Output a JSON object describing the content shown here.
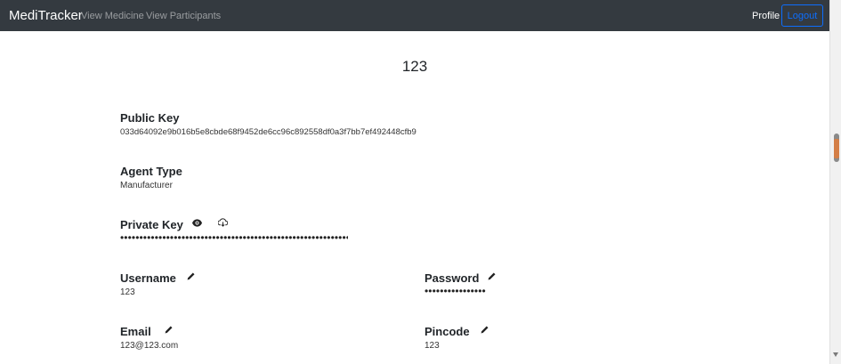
{
  "navbar": {
    "brand": "MediTracker",
    "links": [
      "View Medicine",
      "View Participants"
    ],
    "profile": "Profile",
    "logout": "Logout"
  },
  "profile": {
    "title": "123",
    "public_key": {
      "label": "Public Key",
      "value": "033d64092e9b016b5e8cbde68f9452de6cc96c892558df0a3f7bb7ef492448cfb9"
    },
    "agent_type": {
      "label": "Agent Type",
      "value": "Manufacturer"
    },
    "private_key": {
      "label": "Private Key",
      "masked_value": "••••••••••••••••••••••••••••••••••••••••••••••••••••••••••••••••",
      "show_icon": "eye-icon",
      "download_icon": "cloud-download-icon"
    },
    "username": {
      "label": "Username",
      "value": "123",
      "edit_icon": "pencil-icon"
    },
    "password": {
      "label": "Password",
      "masked_value": "••••••••••••••••",
      "edit_icon": "pencil-icon"
    },
    "email": {
      "label": "Email",
      "value": "123@123.com",
      "edit_icon": "pencil-icon"
    },
    "pincode": {
      "label": "Pincode",
      "value": "123",
      "edit_icon": "pencil-icon"
    }
  },
  "colors": {
    "navbar_bg": "#343a40",
    "logout_border": "#0d6efd",
    "nav_link": "#9a9da0"
  }
}
